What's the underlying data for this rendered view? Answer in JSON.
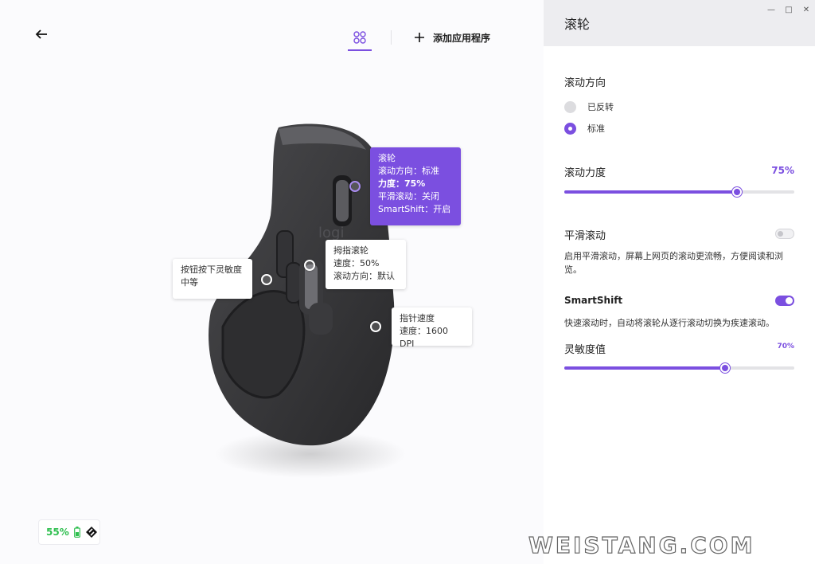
{
  "toolbar": {
    "add_app_label": "添加应用程序"
  },
  "tooltips": {
    "wheel": {
      "title": "滚轮",
      "line1": "滚动方向：标准",
      "line2": "力度：75%",
      "line3": "平滑滚动：关闭",
      "line4": "SmartShift：开启"
    },
    "gesture": {
      "line1": "按钮按下灵敏度",
      "line2": "中等"
    },
    "thumb_wheel": {
      "title": "拇指滚轮",
      "line1": "速度：50%",
      "line2": "滚动方向：默认"
    },
    "pointer": {
      "title": "指针速度",
      "line1": "速度：1600 DPI"
    }
  },
  "mouse": {
    "logo_text": "logi"
  },
  "battery": {
    "percent_label": "55%",
    "level": 0.55
  },
  "panel": {
    "title": "滚轮",
    "scroll_direction": {
      "label": "滚动方向",
      "options": [
        "已反转",
        "标准"
      ],
      "selected": "标准"
    },
    "scroll_force": {
      "label": "滚动力度",
      "value_label": "75%",
      "value": 0.75
    },
    "smooth_scroll": {
      "label": "平滑滚动",
      "enabled": false,
      "description": "启用平滑滚动，屏幕上网页的滚动更流畅，方便阅读和浏览。"
    },
    "smartshift": {
      "label": "SmartShift",
      "enabled": true,
      "description": "快速滚动时，自动将滚轮从逐行滚动切换为疾速滚动。"
    },
    "sensitivity": {
      "label": "灵敏度值",
      "value_label": "70%",
      "value": 0.7
    }
  },
  "watermark": "WEISTANG.COM",
  "colors": {
    "accent": "#7b4fe0",
    "battery_green": "#2fbf4f"
  }
}
